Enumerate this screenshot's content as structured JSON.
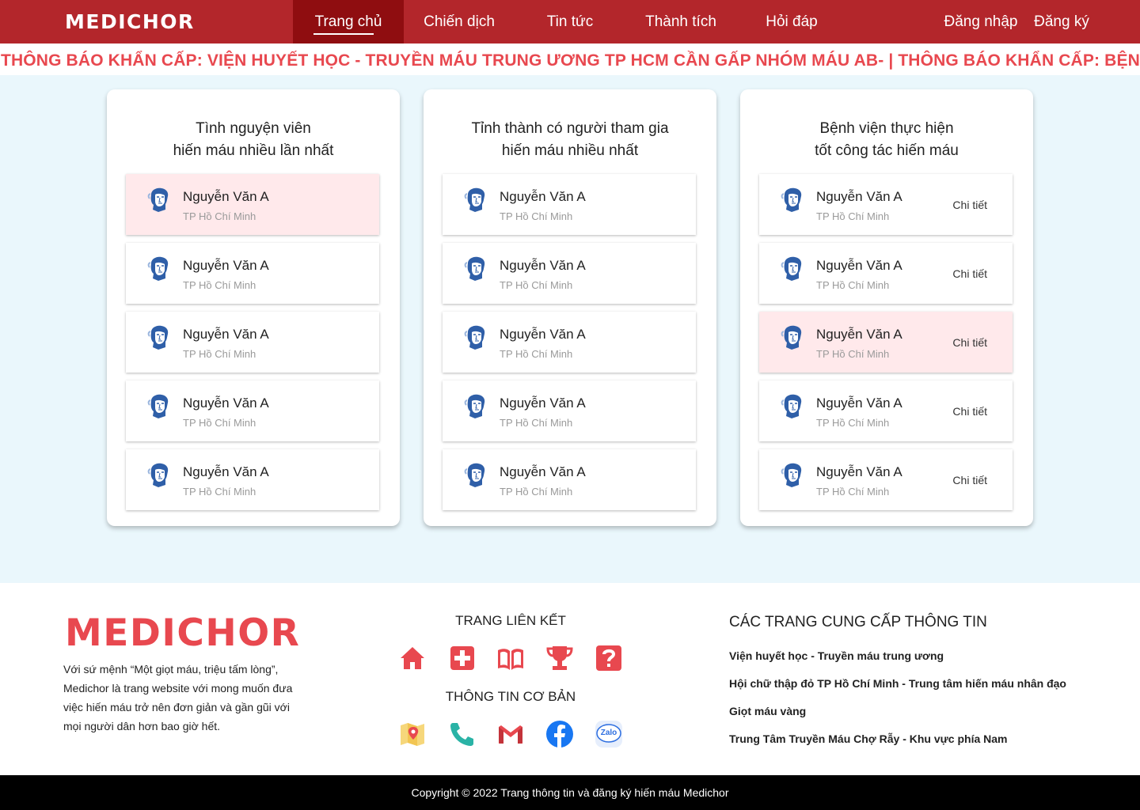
{
  "nav": {
    "logo": "MEDICHOR",
    "items": [
      "Trang chủ",
      "Chiến dịch",
      "Tin tức",
      "Thành tích",
      "Hỏi đáp"
    ],
    "login": "Đăng nhập",
    "register": "Đăng ký"
  },
  "ticker": "THÔNG BÁO KHẨN CẤP: VIỆN HUYẾT HỌC - TRUYỀN MÁU TRUNG ƯƠNG TP HCM CẦN GẤP NHÓM MÁU AB-  |  THÔNG BÁO KHẨN CẤP: BỆNH VIỆN",
  "cards": [
    {
      "title_line1": "Tình nguyện viên",
      "title_line2": "hiến máu nhiều lần nhất",
      "rows": [
        {
          "name": "Nguyễn Văn A",
          "city": "TP Hồ Chí Minh"
        },
        {
          "name": "Nguyễn Văn A",
          "city": "TP Hồ Chí Minh"
        },
        {
          "name": "Nguyễn Văn A",
          "city": "TP Hồ Chí Minh"
        },
        {
          "name": "Nguyễn Văn A",
          "city": "TP Hồ Chí Minh"
        },
        {
          "name": "Nguyễn Văn A",
          "city": "TP Hồ Chí Minh"
        }
      ]
    },
    {
      "title_line1": "Tỉnh thành có người tham gia",
      "title_line2": "hiến máu nhiều nhất",
      "rows": [
        {
          "name": "Nguyễn Văn A",
          "city": "TP Hồ Chí Minh"
        },
        {
          "name": "Nguyễn Văn A",
          "city": "TP Hồ Chí Minh"
        },
        {
          "name": "Nguyễn Văn A",
          "city": "TP Hồ Chí Minh"
        },
        {
          "name": "Nguyễn Văn A",
          "city": "TP Hồ Chí Minh"
        },
        {
          "name": "Nguyễn Văn A",
          "city": "TP Hồ Chí Minh"
        }
      ]
    },
    {
      "title_line1": "Bệnh viện thực hiện",
      "title_line2": "tốt công tác hiến máu",
      "detail_label": "Chi tiết",
      "rows": [
        {
          "name": "Nguyễn Văn A",
          "city": "TP Hồ Chí Minh"
        },
        {
          "name": "Nguyễn Văn A",
          "city": "TP Hồ Chí Minh"
        },
        {
          "name": "Nguyễn Văn A",
          "city": "TP Hồ Chí Minh"
        },
        {
          "name": "Nguyễn Văn A",
          "city": "TP Hồ Chí Minh"
        },
        {
          "name": "Nguyễn Văn A",
          "city": "TP Hồ Chí Minh"
        }
      ]
    }
  ],
  "footer": {
    "logo": "MEDICHOR",
    "mission_line1": "Với sứ mệnh “Một giọt máu, triệu tấm lòng”,",
    "mission_line2": "Medichor là trang website với mong muốn đưa",
    "mission_line3": "việc hiến máu trở nên đơn giản và gần gũi với",
    "mission_line4": "mọi người dân hơn bao giờ hết.",
    "links_title": "TRANG LIÊN KẾT",
    "info_title": "THÔNG TIN CƠ BẢN",
    "providers_title": "CÁC TRANG CUNG CẤP THÔNG TIN",
    "providers": [
      "Viện huyết học - Truyền máu trung ương",
      "Hội chữ thập đỏ TP Hồ Chí Minh - Trung tâm hiến máu nhân đạo",
      "Giọt máu vàng",
      "Trung Tâm Truyền Máu Chợ Rẫy - Khu vực phía Nam"
    ],
    "zalo_label": "Zalo",
    "accent_color": "#e8484f"
  },
  "copyright": "Copyright © 2022 Trang thông tin và đăng ký hiến máu Medichor"
}
